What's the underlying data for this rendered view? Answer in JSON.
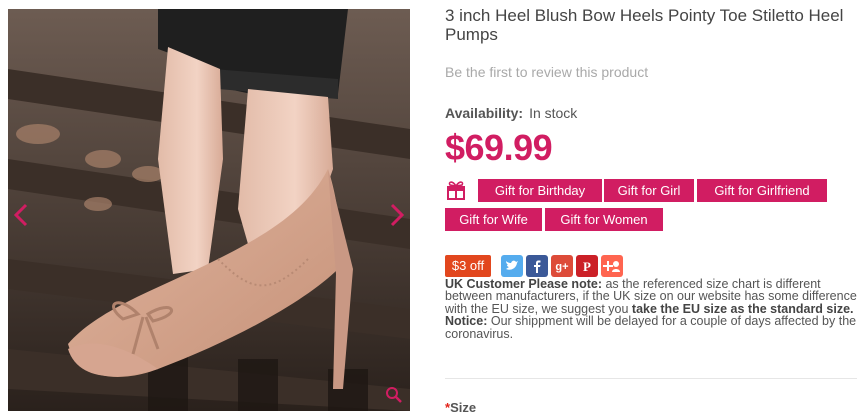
{
  "product": {
    "title": "3 inch Heel Blush Bow Heels Pointy Toe Stiletto Heel Pumps",
    "review_link": "Be the first to review this product",
    "availability_label": "Availability:",
    "availability_value": "In stock",
    "price": "$69.99"
  },
  "gallery": {
    "prev_icon": "chevron-left-icon",
    "next_icon": "chevron-right-icon",
    "zoom_icon": "magnifier-icon"
  },
  "gift_tags": [
    "Gift for Birthday",
    "Gift for Girl",
    "Gift for Girlfriend",
    "Gift for Wife",
    "Gift for Women"
  ],
  "coupon": "$3 off",
  "share_buttons": [
    "twitter-icon",
    "facebook-icon",
    "google-plus-icon",
    "pinterest-icon",
    "add-share-icon"
  ],
  "notice": {
    "uk_label": "UK Customer Please note:",
    "uk_text": " as the referenced size chart is different between manufacturers, if the UK size on our website has some difference with the EU size, we suggest you ",
    "uk_emphasis": "take the EU size as the standard size.",
    "notice_label": "Notice:",
    "notice_text": " Our shippment will be delayed for a couple of days affected by the coronavirus."
  },
  "size": {
    "required_mark": "*",
    "label": "Size"
  },
  "colors": {
    "accent": "#d11d62",
    "coupon": "#e2471e",
    "twitter": "#55acee",
    "facebook": "#3b5998",
    "google_plus": "#dd4b39",
    "pinterest": "#cb2027",
    "add_share": "#ff6550"
  }
}
